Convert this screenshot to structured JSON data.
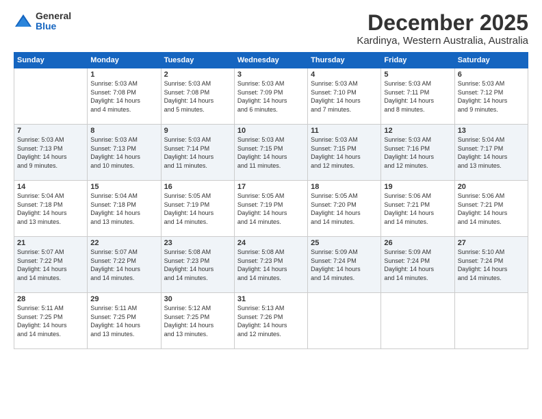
{
  "logo": {
    "general": "General",
    "blue": "Blue"
  },
  "header": {
    "month": "December 2025",
    "location": "Kardinya, Western Australia, Australia"
  },
  "weekdays": [
    "Sunday",
    "Monday",
    "Tuesday",
    "Wednesday",
    "Thursday",
    "Friday",
    "Saturday"
  ],
  "weeks": [
    [
      {
        "day": "",
        "info": ""
      },
      {
        "day": "1",
        "info": "Sunrise: 5:03 AM\nSunset: 7:08 PM\nDaylight: 14 hours\nand 4 minutes."
      },
      {
        "day": "2",
        "info": "Sunrise: 5:03 AM\nSunset: 7:08 PM\nDaylight: 14 hours\nand 5 minutes."
      },
      {
        "day": "3",
        "info": "Sunrise: 5:03 AM\nSunset: 7:09 PM\nDaylight: 14 hours\nand 6 minutes."
      },
      {
        "day": "4",
        "info": "Sunrise: 5:03 AM\nSunset: 7:10 PM\nDaylight: 14 hours\nand 7 minutes."
      },
      {
        "day": "5",
        "info": "Sunrise: 5:03 AM\nSunset: 7:11 PM\nDaylight: 14 hours\nand 8 minutes."
      },
      {
        "day": "6",
        "info": "Sunrise: 5:03 AM\nSunset: 7:12 PM\nDaylight: 14 hours\nand 9 minutes."
      }
    ],
    [
      {
        "day": "7",
        "info": "Sunrise: 5:03 AM\nSunset: 7:13 PM\nDaylight: 14 hours\nand 9 minutes."
      },
      {
        "day": "8",
        "info": "Sunrise: 5:03 AM\nSunset: 7:13 PM\nDaylight: 14 hours\nand 10 minutes."
      },
      {
        "day": "9",
        "info": "Sunrise: 5:03 AM\nSunset: 7:14 PM\nDaylight: 14 hours\nand 11 minutes."
      },
      {
        "day": "10",
        "info": "Sunrise: 5:03 AM\nSunset: 7:15 PM\nDaylight: 14 hours\nand 11 minutes."
      },
      {
        "day": "11",
        "info": "Sunrise: 5:03 AM\nSunset: 7:15 PM\nDaylight: 14 hours\nand 12 minutes."
      },
      {
        "day": "12",
        "info": "Sunrise: 5:03 AM\nSunset: 7:16 PM\nDaylight: 14 hours\nand 12 minutes."
      },
      {
        "day": "13",
        "info": "Sunrise: 5:04 AM\nSunset: 7:17 PM\nDaylight: 14 hours\nand 13 minutes."
      }
    ],
    [
      {
        "day": "14",
        "info": "Sunrise: 5:04 AM\nSunset: 7:18 PM\nDaylight: 14 hours\nand 13 minutes."
      },
      {
        "day": "15",
        "info": "Sunrise: 5:04 AM\nSunset: 7:18 PM\nDaylight: 14 hours\nand 13 minutes."
      },
      {
        "day": "16",
        "info": "Sunrise: 5:05 AM\nSunset: 7:19 PM\nDaylight: 14 hours\nand 14 minutes."
      },
      {
        "day": "17",
        "info": "Sunrise: 5:05 AM\nSunset: 7:19 PM\nDaylight: 14 hours\nand 14 minutes."
      },
      {
        "day": "18",
        "info": "Sunrise: 5:05 AM\nSunset: 7:20 PM\nDaylight: 14 hours\nand 14 minutes."
      },
      {
        "day": "19",
        "info": "Sunrise: 5:06 AM\nSunset: 7:21 PM\nDaylight: 14 hours\nand 14 minutes."
      },
      {
        "day": "20",
        "info": "Sunrise: 5:06 AM\nSunset: 7:21 PM\nDaylight: 14 hours\nand 14 minutes."
      }
    ],
    [
      {
        "day": "21",
        "info": "Sunrise: 5:07 AM\nSunset: 7:22 PM\nDaylight: 14 hours\nand 14 minutes."
      },
      {
        "day": "22",
        "info": "Sunrise: 5:07 AM\nSunset: 7:22 PM\nDaylight: 14 hours\nand 14 minutes."
      },
      {
        "day": "23",
        "info": "Sunrise: 5:08 AM\nSunset: 7:23 PM\nDaylight: 14 hours\nand 14 minutes."
      },
      {
        "day": "24",
        "info": "Sunrise: 5:08 AM\nSunset: 7:23 PM\nDaylight: 14 hours\nand 14 minutes."
      },
      {
        "day": "25",
        "info": "Sunrise: 5:09 AM\nSunset: 7:24 PM\nDaylight: 14 hours\nand 14 minutes."
      },
      {
        "day": "26",
        "info": "Sunrise: 5:09 AM\nSunset: 7:24 PM\nDaylight: 14 hours\nand 14 minutes."
      },
      {
        "day": "27",
        "info": "Sunrise: 5:10 AM\nSunset: 7:24 PM\nDaylight: 14 hours\nand 14 minutes."
      }
    ],
    [
      {
        "day": "28",
        "info": "Sunrise: 5:11 AM\nSunset: 7:25 PM\nDaylight: 14 hours\nand 14 minutes."
      },
      {
        "day": "29",
        "info": "Sunrise: 5:11 AM\nSunset: 7:25 PM\nDaylight: 14 hours\nand 13 minutes."
      },
      {
        "day": "30",
        "info": "Sunrise: 5:12 AM\nSunset: 7:25 PM\nDaylight: 14 hours\nand 13 minutes."
      },
      {
        "day": "31",
        "info": "Sunrise: 5:13 AM\nSunset: 7:26 PM\nDaylight: 14 hours\nand 12 minutes."
      },
      {
        "day": "",
        "info": ""
      },
      {
        "day": "",
        "info": ""
      },
      {
        "day": "",
        "info": ""
      }
    ]
  ]
}
